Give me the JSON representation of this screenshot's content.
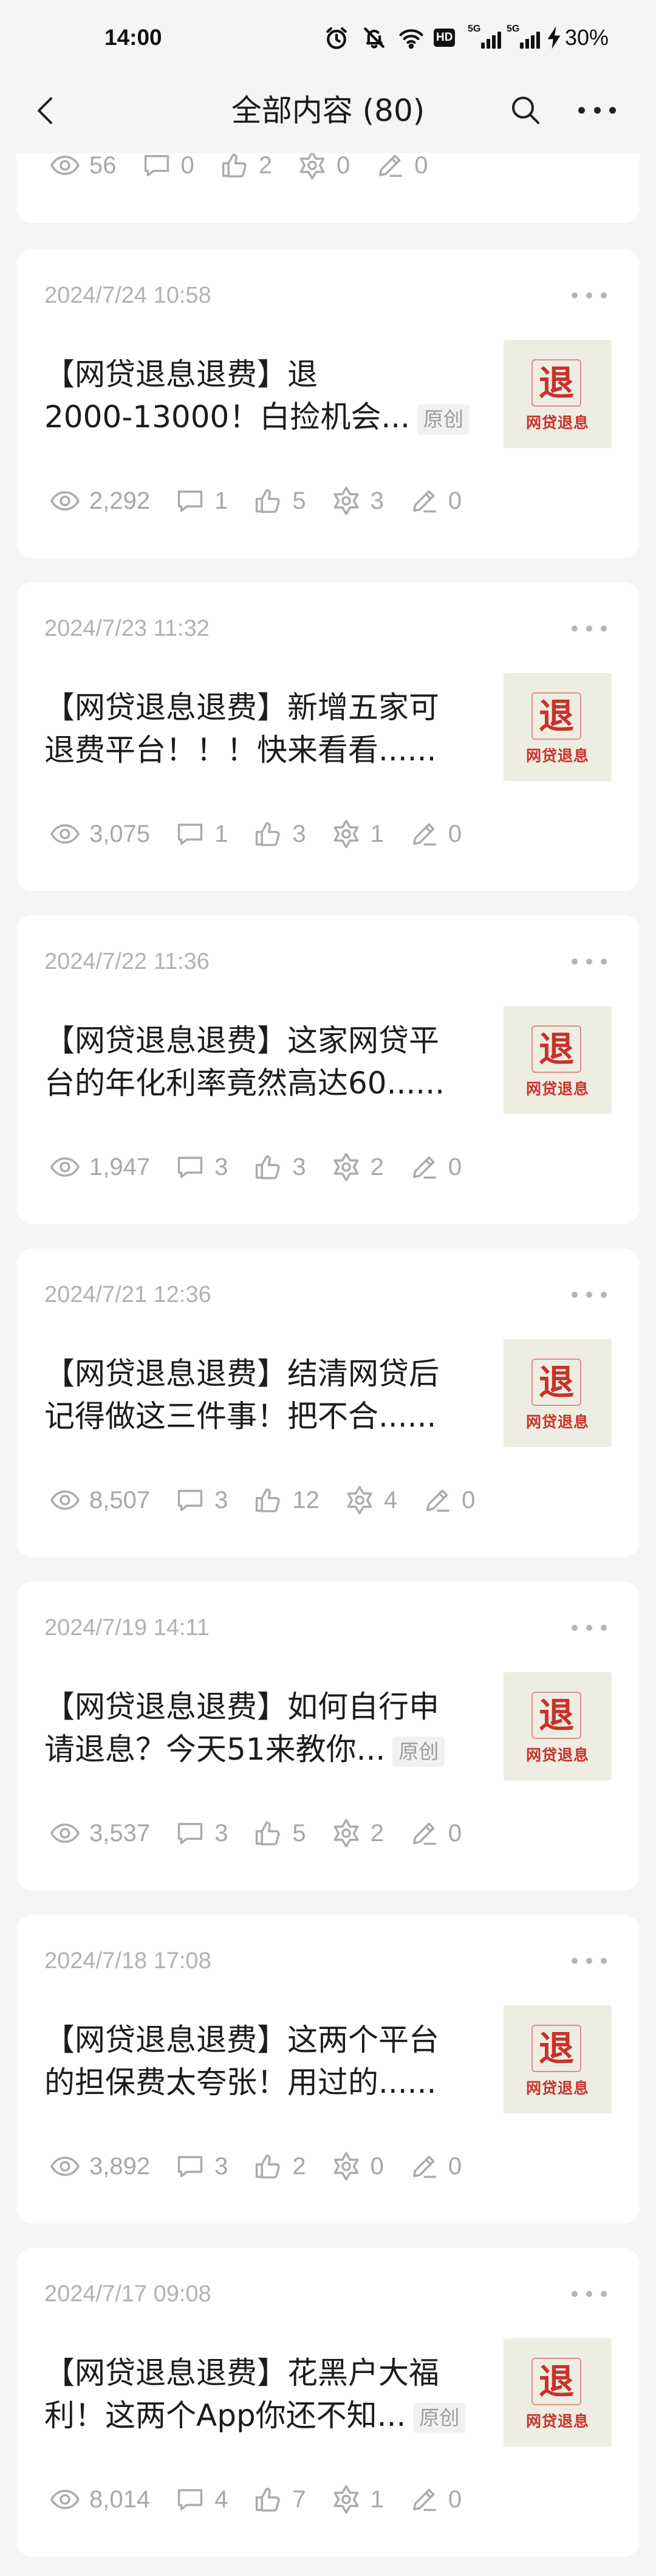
{
  "status_bar": {
    "time": "14:00",
    "hd_badge": "HD",
    "signal_1_label": "5G",
    "signal_2_label": "5G",
    "battery": "30%",
    "icons": [
      "alarm-icon",
      "mute-icon",
      "wifi-icon",
      "signal-icon",
      "charging-icon"
    ]
  },
  "header": {
    "title": "全部内容 (80)",
    "icons": [
      "back-icon",
      "search-icon",
      "more-icon"
    ]
  },
  "colors": {
    "page_background": "#f5f5f5",
    "card_background": "#ffffff",
    "title_text": "#1c1c1c",
    "meta_text": "#b2b2b2",
    "thumbnail_background": "#eeede2",
    "thumbnail_accent": "#c8322a"
  },
  "thumbnail": {
    "glyph": "退",
    "caption": "网贷退息"
  },
  "stat_icons": [
    "eye-icon",
    "comment-icon",
    "thumbs-up-icon",
    "flower-icon",
    "pen-icon"
  ],
  "partial_post": {
    "stats": {
      "views": "56",
      "comments": "0",
      "likes": "2",
      "wows": "0",
      "notes": "0"
    }
  },
  "posts": [
    {
      "date": "2024/7/24 10:58",
      "title_lines": [
        "【网贷退息退费】退",
        "2000-13000！白捡机会..."
      ],
      "tag": "原创",
      "stats": {
        "views": "2,292",
        "comments": "1",
        "likes": "5",
        "wows": "3",
        "notes": "0"
      }
    },
    {
      "date": "2024/7/23 11:32",
      "title_lines": [
        "【网贷退息退费】新增五家可",
        "退费平台！！！快来看看......"
      ],
      "stats": {
        "views": "3,075",
        "comments": "1",
        "likes": "3",
        "wows": "1",
        "notes": "0"
      }
    },
    {
      "date": "2024/7/22 11:36",
      "title_lines": [
        "【网贷退息退费】这家网贷平",
        "台的年化利率竟然高达60......"
      ],
      "stats": {
        "views": "1,947",
        "comments": "3",
        "likes": "3",
        "wows": "2",
        "notes": "0"
      }
    },
    {
      "date": "2024/7/21 12:36",
      "title_lines": [
        "【网贷退息退费】结清网贷后",
        "记得做这三件事！把不合......"
      ],
      "stats": {
        "views": "8,507",
        "comments": "3",
        "likes": "12",
        "wows": "4",
        "notes": "0"
      }
    },
    {
      "date": "2024/7/19 14:11",
      "title_lines": [
        "【网贷退息退费】如何自行申",
        "请退息？今天51来教你..."
      ],
      "tag": "原创",
      "stats": {
        "views": "3,537",
        "comments": "3",
        "likes": "5",
        "wows": "2",
        "notes": "0"
      }
    },
    {
      "date": "2024/7/18 17:08",
      "title_lines": [
        "【网贷退息退费】这两个平台",
        "的担保费太夸张！用过的......"
      ],
      "stats": {
        "views": "3,892",
        "comments": "3",
        "likes": "2",
        "wows": "0",
        "notes": "0"
      }
    },
    {
      "date": "2024/7/17 09:08",
      "title_lines": [
        "【网贷退息退费】花黑户大福",
        "利！这两个App你还不知..."
      ],
      "tag": "原创",
      "stats": {
        "views": "8,014",
        "comments": "4",
        "likes": "7",
        "wows": "1",
        "notes": "0"
      }
    }
  ]
}
